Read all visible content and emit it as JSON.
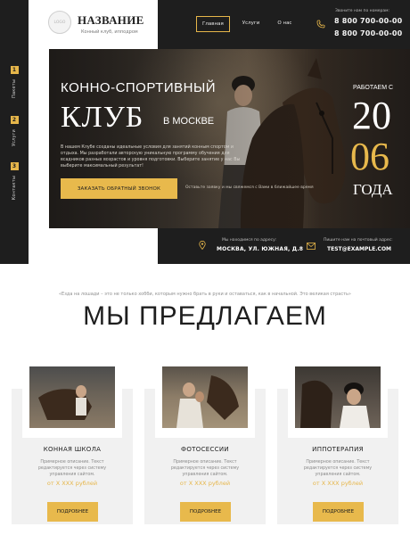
{
  "side_menu": [
    {
      "num": "1",
      "label": "Пакеты"
    },
    {
      "num": "2",
      "label": "Услуги"
    },
    {
      "num": "3",
      "label": "Контакты"
    }
  ],
  "brand": {
    "logo": "LOGO",
    "name": "НАЗВАНИЕ",
    "subtitle": "Конный клуб, ипподром"
  },
  "nav": [
    "Главная",
    "Услуги",
    "О нас"
  ],
  "contacts_top": {
    "callback_label": "Звоните нам по номерам:",
    "phones": [
      "8 800 700-00-00",
      "8 800 700-00-00"
    ]
  },
  "hero": {
    "line1": "КОННО-СПОРТИВНЫЙ",
    "club": "КЛУБ",
    "city": "В МОСКВЕ",
    "description": "В нашем Клубе созданы идеальные условия для занятий конным спортом и отдыха. Мы разработали авторскую уникальную программу обучения для всадников разных возрастов и уровня подготовки. Выберите занятие у нас Вы выберите максимальный результат!",
    "cta": "ЗАКАЗАТЬ ОБРАТНЫЙ ЗВОНОК",
    "note": "Оставьте заявку и мы свяжемся с Вами в ближайшее время",
    "since_label": "РАБОТАЕМ С",
    "since_day": "20",
    "since_month": "06",
    "since_word": "ГОДА"
  },
  "contact_strip": {
    "address_label": "Мы находимся по адресу:",
    "address": "МОСКВА, УЛ. ЮЖНАЯ, Д.8",
    "email_label": "Пишите нам на почтовый адрес:",
    "email": "TEST@EXAMPLE.COM"
  },
  "offers": {
    "quote": "«Езда на лошади – это не только хобби, которым нужно брать в руки и оставаться, как в начальной. Это великая страсть»",
    "title": "МЫ ПРЕДЛАГАЕМ",
    "cards": [
      {
        "title": "КОННАЯ ШКОЛА",
        "description": "Примерное описание. Текст редактируется через систему управления сайтом.",
        "price": "от X XXX рублей",
        "button": "ПОДРОБНЕЕ"
      },
      {
        "title": "ФОТОСЕССИИ",
        "description": "Примерное описание. Текст редактируется через систему управления сайтом.",
        "price": "от X XXX рублей",
        "button": "ПОДРОБНЕЕ"
      },
      {
        "title": "ИППОТЕРАПИЯ",
        "description": "Примерное описание. Текст редактируется через систему управления сайтом.",
        "price": "от X XXX рублей",
        "button": "ПОДРОБНЕЕ"
      }
    ]
  },
  "colors": {
    "accent": "#e8b94c",
    "dark": "#1e1e1e",
    "card_bg": "#f1f1f1"
  },
  "icons": [
    "phone-icon",
    "map-pin-icon",
    "mail-icon"
  ]
}
